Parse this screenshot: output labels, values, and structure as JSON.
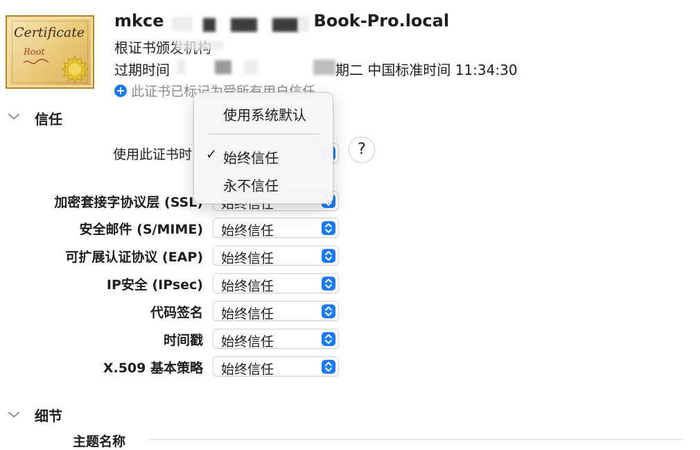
{
  "header": {
    "cert_icon": {
      "title": "Certificate",
      "subtitle": "Root"
    },
    "name_prefix": "mkce",
    "name_suffix": "Book-Pro.local",
    "issuer": "根证书颁发机构",
    "expiry_prefix": "过期时间",
    "expiry_suffix": "期二 中国标准时间 11:34:30",
    "trust_note": "此证书已标记为受所有用户信任"
  },
  "sections": {
    "trust": {
      "title": "信任"
    },
    "details": {
      "title": "细节",
      "subject_name": "主题名称"
    }
  },
  "trust_settings": {
    "use_label": "使用此证书时",
    "rows": [
      {
        "label": "加密套接字协议层 (SSL)",
        "value": "始终信任"
      },
      {
        "label": "安全邮件 (S/MIME)",
        "value": "始终信任"
      },
      {
        "label": "可扩展认证协议 (EAP)",
        "value": "始终信任"
      },
      {
        "label": "IP安全 (IPsec)",
        "value": "始终信任"
      },
      {
        "label": "代码签名",
        "value": "始终信任"
      },
      {
        "label": "时间戳",
        "value": "始终信任"
      },
      {
        "label": "X.509 基本策略",
        "value": "始终信任"
      }
    ]
  },
  "menu": {
    "items": [
      {
        "label": "使用系统默认",
        "checked": false
      },
      {
        "label": "始终信任",
        "checked": true,
        "check_mark": "✓"
      },
      {
        "label": "永不信任",
        "checked": false
      }
    ]
  },
  "help": {
    "label": "?"
  },
  "icons": {
    "collapse_trust": "chevron-down-icon",
    "collapse_details": "chevron-down-icon",
    "trust_note": "plus-circle-icon",
    "stepper": "up-down-arrows-icon",
    "certificate": "certificate-icon"
  },
  "colors": {
    "accent": "#1a7cf5",
    "secondary_text": "#8a8a8e"
  }
}
